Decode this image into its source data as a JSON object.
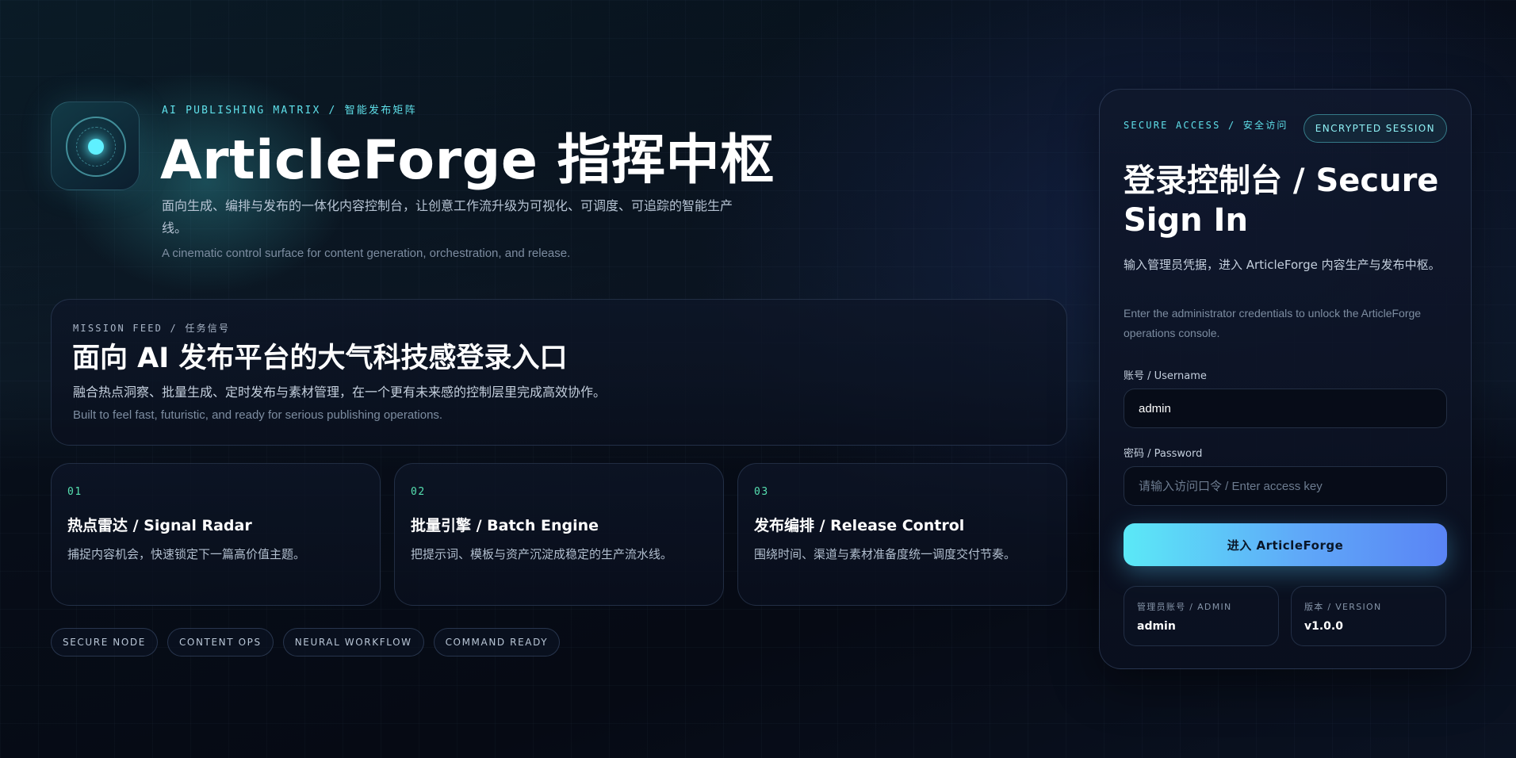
{
  "hero": {
    "eyebrow": "AI PUBLISHING MATRIX / 智能发布矩阵",
    "title": "ArticleForge 指挥中枢",
    "description": "面向生成、编排与发布的一体化内容控制台，让创意工作流升级为可视化、可调度、可追踪的智能生产线。",
    "subtitle": "A cinematic control surface for content generation, orchestration, and release."
  },
  "mission": {
    "eyebrow": "MISSION FEED / 任务信号",
    "title": "面向 AI 发布平台的大气科技感登录入口",
    "description": "融合热点洞察、批量生成、定时发布与素材管理，在一个更有未来感的控制层里完成高效协作。",
    "subtitle": "Built to feel fast, futuristic, and ready for serious publishing operations."
  },
  "features": [
    {
      "number": "01",
      "title": "热点雷达 / Signal Radar",
      "description": "捕捉内容机会，快速锁定下一篇高价值主题。"
    },
    {
      "number": "02",
      "title": "批量引擎 / Batch Engine",
      "description": "把提示词、模板与资产沉淀成稳定的生产流水线。"
    },
    {
      "number": "03",
      "title": "发布编排 / Release Control",
      "description": "围绕时间、渠道与素材准备度统一调度交付节奏。"
    }
  ],
  "pills": [
    "SECURE NODE",
    "CONTENT OPS",
    "NEURAL WORKFLOW",
    "COMMAND READY"
  ],
  "login": {
    "eyebrow": "SECURE ACCESS / 安全访问",
    "badge": "ENCRYPTED SESSION",
    "title": "登录控制台 / Secure Sign In",
    "description": "输入管理员凭据，进入 ArticleForge 内容生产与发布中枢。",
    "subtitle": "Enter the administrator credentials to unlock the ArticleForge operations console.",
    "username_label": "账号 / Username",
    "username_value": "admin",
    "password_label": "密码 / Password",
    "password_placeholder": "请输入访问口令 / Enter access key",
    "submit_label": "进入 ArticleForge",
    "admin_label": "管理员账号 / ADMIN",
    "admin_value": "admin",
    "version_label": "版本 / VERSION",
    "version_value": "v1.0.0"
  },
  "colors": {
    "accent_cyan": "#5fe0ea",
    "accent_green": "#56e0b0",
    "button_gradient_start": "#5be9f7",
    "button_gradient_end": "#5a84f5",
    "background": "#070d18"
  },
  "icons": {
    "logo": "orbit-core-icon"
  }
}
